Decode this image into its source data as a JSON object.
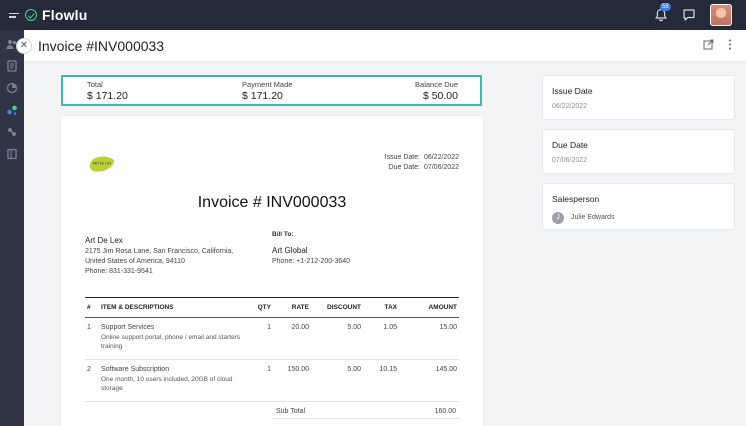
{
  "app": {
    "name": "Flowlu",
    "notification_count": "58"
  },
  "header": {
    "title": "Invoice #INV000033"
  },
  "summary": {
    "total_label": "Total",
    "total_value": "$ 171.20",
    "paid_label": "Payment Made",
    "paid_value": "$ 171.20",
    "due_label": "Balance Due",
    "due_value": "$ 50.00"
  },
  "invoice": {
    "logo_text": "ART DE LEX",
    "issue_date_label": "Issue Date:",
    "issue_date": "06/22/2022",
    "due_date_label": "Due Date:",
    "due_date": "07/06/2022",
    "title": "Invoice # INV000033",
    "from": {
      "name": "Art De Lex",
      "address1": "2175 Jim Rosa Lane, San Francisco, California,",
      "address2": "United States of America, 94110",
      "phone": "Phone: 831-331-9541"
    },
    "bill_to": {
      "heading": "Bill To:",
      "name": "Art Global",
      "phone": "Phone: +1-212-200-3640"
    },
    "columns": {
      "num": "#",
      "item": "ITEM & DESCRIPTIONS",
      "qty": "QTY",
      "rate": "RATE",
      "discount": "DISCOUNT",
      "tax": "TAX",
      "amount": "AMOUNT"
    },
    "items": [
      {
        "num": "1",
        "name": "Support Services",
        "desc1": "Online support portal, phone / email and starters",
        "desc2": "training",
        "qty": "1",
        "rate": "20.00",
        "discount": "5.00",
        "tax": "1.05",
        "amount": "15.00"
      },
      {
        "num": "2",
        "name": "Software Subscription",
        "desc1": "One month, 10 users included, 20GB of cloud",
        "desc2": "storage",
        "qty": "1",
        "rate": "150.00",
        "discount": "5.00",
        "tax": "10.15",
        "amount": "145.00"
      }
    ],
    "subtotal_label": "Sub Total",
    "subtotal_value": "160.00"
  },
  "sidebar": {
    "issue_date": {
      "title": "Issue Date",
      "value": "06/22/2022"
    },
    "due_date": {
      "title": "Due Date",
      "value": "07/06/2022"
    },
    "salesperson": {
      "title": "Salesperson",
      "initial": "J",
      "name": "Julie Edwards"
    }
  },
  "colors": {
    "accent": "#3fb8b4",
    "topbar": "#252a3a",
    "rail": "#2f3446",
    "brand_green": "#4ad07a"
  }
}
